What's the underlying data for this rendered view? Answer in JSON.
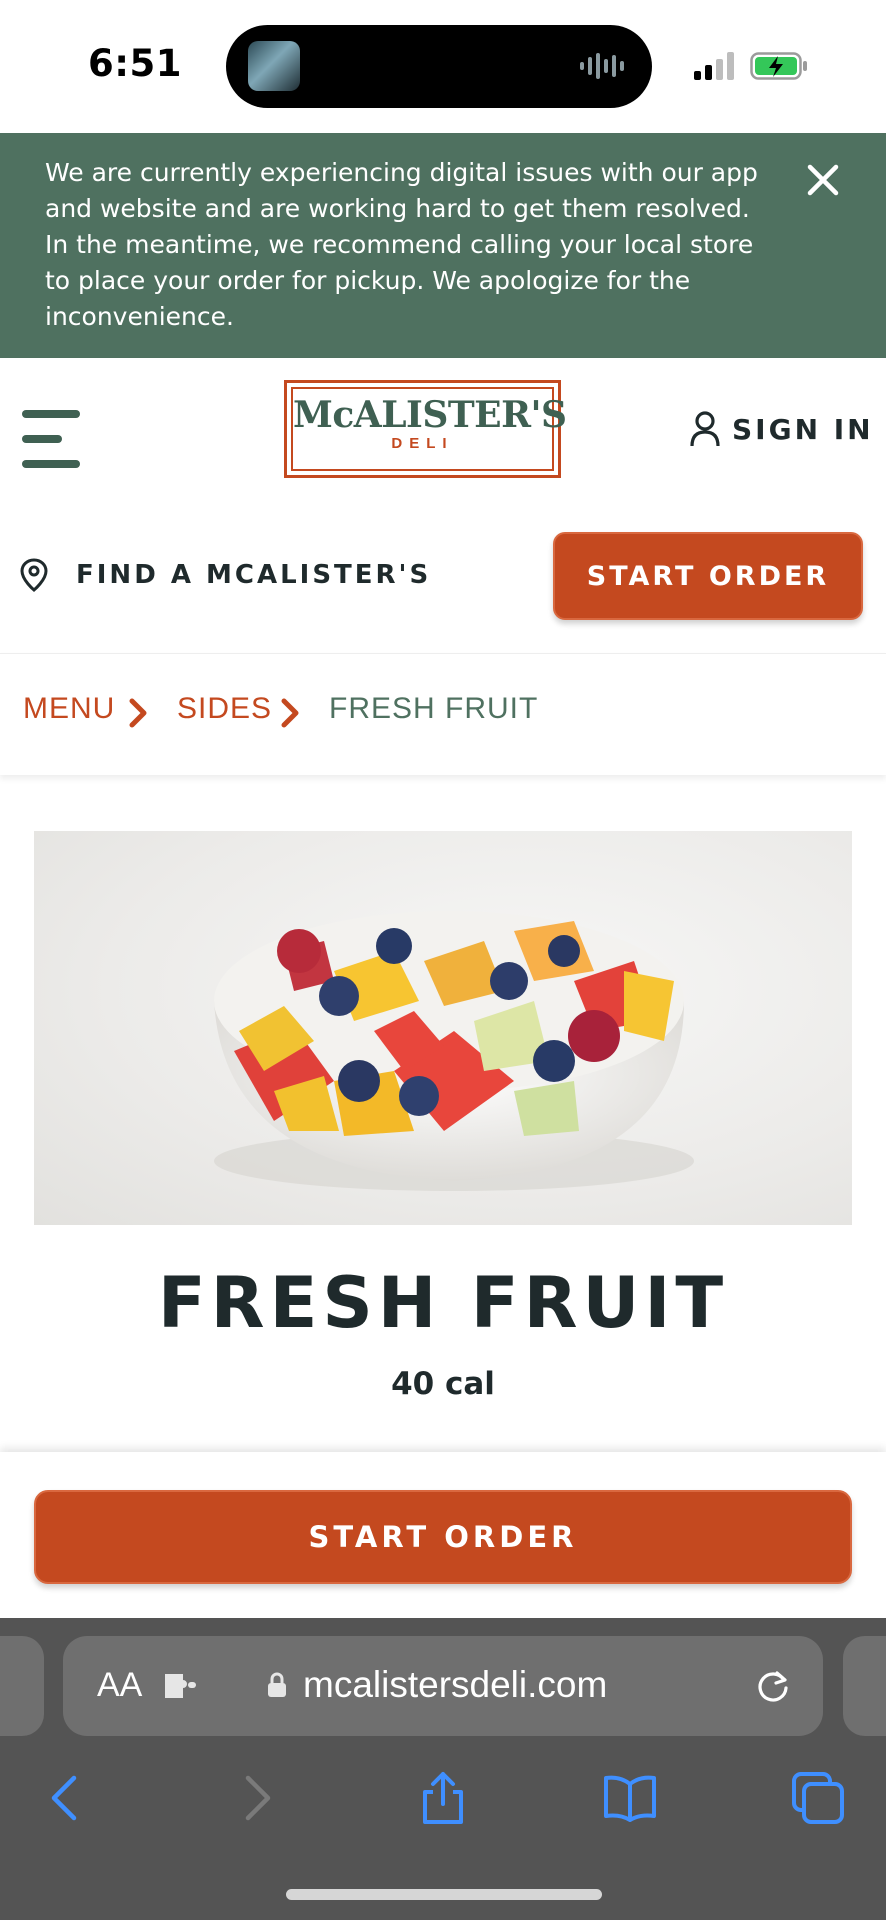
{
  "status_bar": {
    "time": "6:51",
    "icons": [
      "now-playing-art",
      "audio-waveform",
      "cellular-signal-icon",
      "battery-charging-icon"
    ]
  },
  "alert": {
    "message": "We are currently experiencing digital issues with our app and website and are working hard to get them resolved. In the meantime, we recommend calling your local store to place your order for pickup. We apologize for the inconvenience.",
    "close_icon": "close-icon"
  },
  "header": {
    "menu_icon": "hamburger-menu-icon",
    "logo": {
      "name": "McALISTER'S",
      "sub": "DELI"
    },
    "signin_label": "SIGN IN",
    "signin_icon": "user-icon"
  },
  "store": {
    "find_label": "FIND A MCALISTER'S",
    "pin_icon": "location-pin-icon",
    "start_order_label": "START ORDER"
  },
  "breadcrumb": {
    "items": [
      {
        "label": "MENU"
      },
      {
        "label": "SIDES"
      },
      {
        "label": "FRESH FRUIT"
      }
    ]
  },
  "product": {
    "title": "FRESH FRUIT",
    "calories": "40 cal",
    "image": "fresh-fruit-bowl"
  },
  "order_bar": {
    "start_order_label": "START ORDER"
  },
  "browser": {
    "aa_label": "AA",
    "url": "mcalistersdeli.com",
    "toolbar": [
      "back-icon",
      "forward-icon",
      "share-icon",
      "bookmarks-icon",
      "tabs-icon"
    ]
  },
  "colors": {
    "brand_orange": "#c4491f",
    "brand_green": "#4f7160",
    "text_dark": "#1f2a2c",
    "safari_bg": "#545454",
    "safari_blue": "#3f8fff"
  }
}
